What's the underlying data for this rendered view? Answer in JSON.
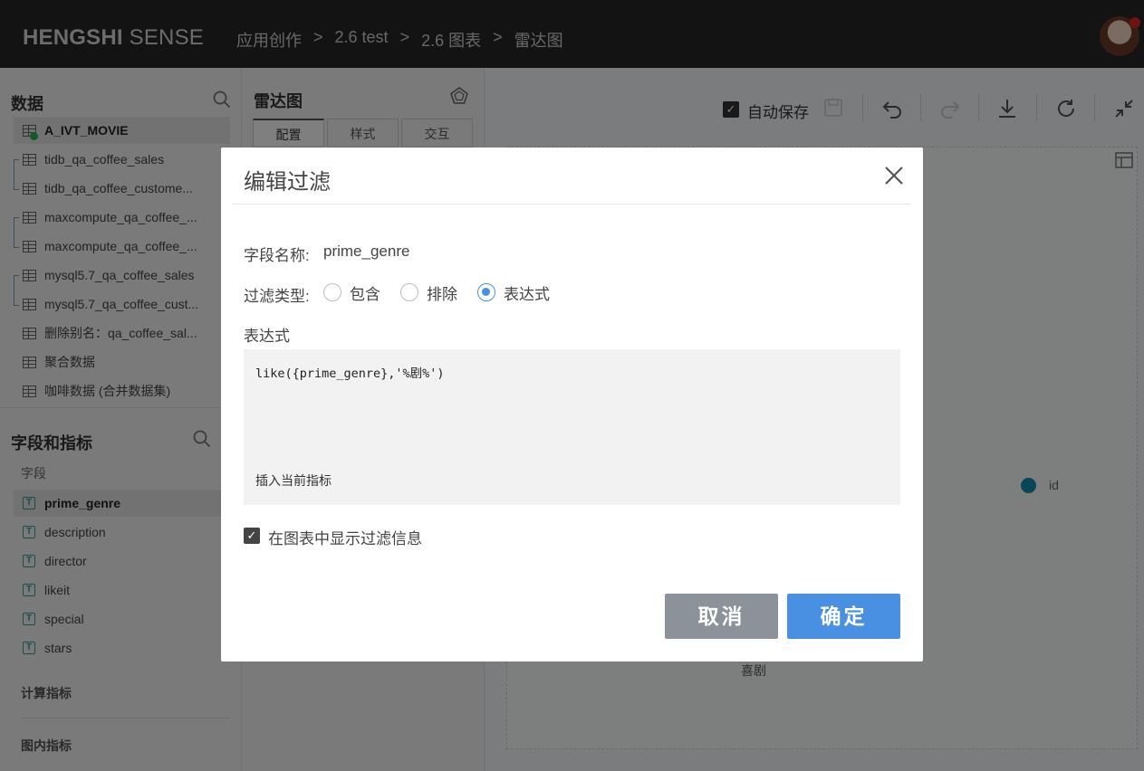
{
  "header": {
    "logo_bold": "HENGSHI",
    "logo_rest": " SENSE",
    "breadcrumbs": [
      "应用创作",
      "2.6 test",
      "2.6 图表",
      "雷达图"
    ],
    "separator": ">"
  },
  "data_panel": {
    "title": "数据",
    "datasets": [
      {
        "label": "A_IVT_MOVIE"
      },
      {
        "label": "tidb_qa_coffee_sales"
      },
      {
        "label": "tidb_qa_coffee_custome..."
      },
      {
        "label": "maxcompute_qa_coffee_..."
      },
      {
        "label": "maxcompute_qa_coffee_..."
      },
      {
        "label": "mysql5.7_qa_coffee_sales"
      },
      {
        "label": "mysql5.7_qa_coffee_cust..."
      },
      {
        "label": "删除别名：qa_coffee_sal..."
      },
      {
        "label": "聚合数据"
      },
      {
        "label": "咖啡数据 (合并数据集)"
      }
    ]
  },
  "fields_panel": {
    "title": "字段和指标",
    "fields_label": "字段",
    "fields": [
      {
        "label": "prime_genre",
        "type": "T"
      },
      {
        "label": "description",
        "type": "T"
      },
      {
        "label": "director",
        "type": "T"
      },
      {
        "label": "likeit",
        "type": "T"
      },
      {
        "label": "special",
        "type": "T"
      },
      {
        "label": "stars",
        "type": "T"
      }
    ],
    "calc_label": "计算指标",
    "inner_label": "图内指标"
  },
  "config_panel": {
    "title": "雷达图",
    "tabs": [
      "配置",
      "样式",
      "交互"
    ]
  },
  "toolbar": {
    "autosave_label": "自动保存",
    "autosave_checked": true
  },
  "chart": {
    "legend_label": "id",
    "legend_color": "#0f8fb0",
    "axis_label": "喜剧"
  },
  "modal": {
    "title": "编辑过滤",
    "field_name_label": "字段名称:",
    "field_name_value": "prime_genre",
    "filter_type_label": "过滤类型:",
    "filter_types": [
      "包含",
      "排除",
      "表达式"
    ],
    "selected_filter_type": "表达式",
    "expression_label": "表达式",
    "expression_value": "like({prime_genre},'%剧%')",
    "insert_metric_label": "插入当前指标",
    "show_filter_label": "在图表中显示过滤信息",
    "show_filter_checked": true,
    "cancel_label": "取消",
    "ok_label": "确定"
  }
}
